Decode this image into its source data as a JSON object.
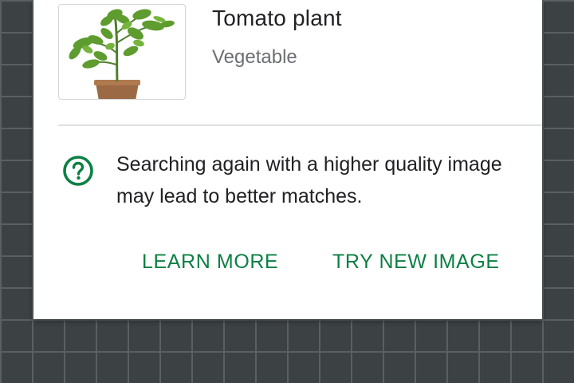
{
  "result": {
    "title": "Tomato plant",
    "category": "Vegetable",
    "thumbnail_icon": "tomato-plant-image"
  },
  "hint": {
    "icon": "help-circle-icon",
    "text": "Searching again with a higher quality image may lead to better matches."
  },
  "actions": {
    "learn_more_label": "LEARN MORE",
    "try_new_image_label": "TRY NEW IMAGE"
  },
  "colors": {
    "accent": "#0b8043",
    "background": "#3c4143",
    "grid_line": "#596062",
    "card": "#ffffff",
    "title_text": "#202124",
    "subtitle_text": "#6b6e72"
  }
}
